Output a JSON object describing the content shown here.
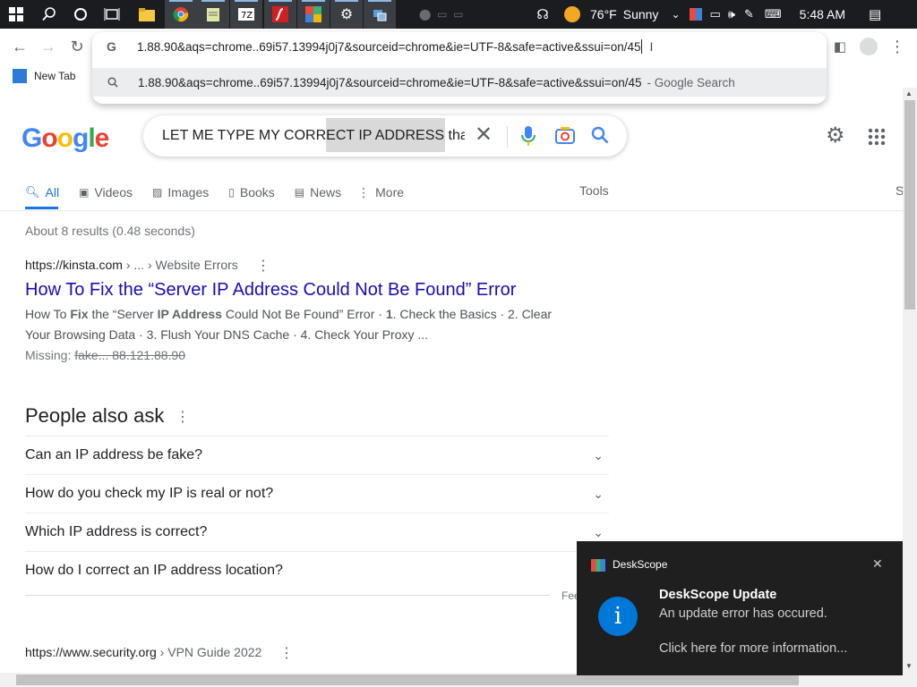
{
  "taskbar": {
    "weather_temp": "76°F",
    "weather_desc": "Sunny",
    "clock": "5:48 AM"
  },
  "browser": {
    "url_text": "1.88.90&aqs=chrome..69i57.13994j0j7&sourceid=chrome&ie=UTF-8&safe=active&ssui=on/45",
    "suggestion_text": "1.88.90&aqs=chrome..69i57.13994j0j7&sourceid=chrome&ie=UTF-8&safe=active&ssui=on/45",
    "suggestion_suffix": "- Google Search",
    "bookmark_label": "New Tab"
  },
  "google": {
    "logo_text": "Google",
    "search_query": "LET ME TYPE MY CORRECT IP ADDRESS tha",
    "tabs": {
      "all": "All",
      "videos": "Videos",
      "images": "Images",
      "books": "Books",
      "news": "News",
      "more": "More",
      "tools": "Tools",
      "safesearch": "S"
    },
    "stats": "About 8 results (0.48 seconds)",
    "result1": {
      "cite_domain": "https://kinsta.com",
      "cite_path": " › ... › Website Errors",
      "title": "How To Fix the “Server IP Address Could Not Be Found” Error",
      "snippet_1a": "How To ",
      "snippet_1b": "Fix",
      "snippet_1c": " the “Server ",
      "snippet_1d": "IP Address",
      "snippet_1e": " Could Not Be Found” Error · ",
      "snippet_1f": "1",
      "snippet_1g": ". Check the Basics · 2. Clear",
      "snippet_2": "Your Browsing Data · 3. Flush Your DNS Cache · 4. Check Your Proxy ...",
      "missing_label": "Missing: ",
      "missing_terms": "fake... 88.121.88.90"
    },
    "paa": {
      "heading": "People also ask",
      "questions": [
        "Can an IP address be fake?",
        "How do you check my IP is real or not?",
        "Which IP address is correct?",
        "How do I correct an IP address location?"
      ],
      "feedback": "Fee"
    },
    "result2": {
      "cite_domain": "https://www.security.org",
      "cite_path": " › VPN Guide 2022"
    }
  },
  "notification": {
    "app_name": "DeskScope",
    "title": "DeskScope Update",
    "message": "An update error has occured.",
    "link": "Click here for more information..."
  },
  "colors": {
    "link_blue": "#1a0dab",
    "google_blue": "#4285f4",
    "toast_bg": "#1f1f1f",
    "info_blue": "#0078d7"
  }
}
